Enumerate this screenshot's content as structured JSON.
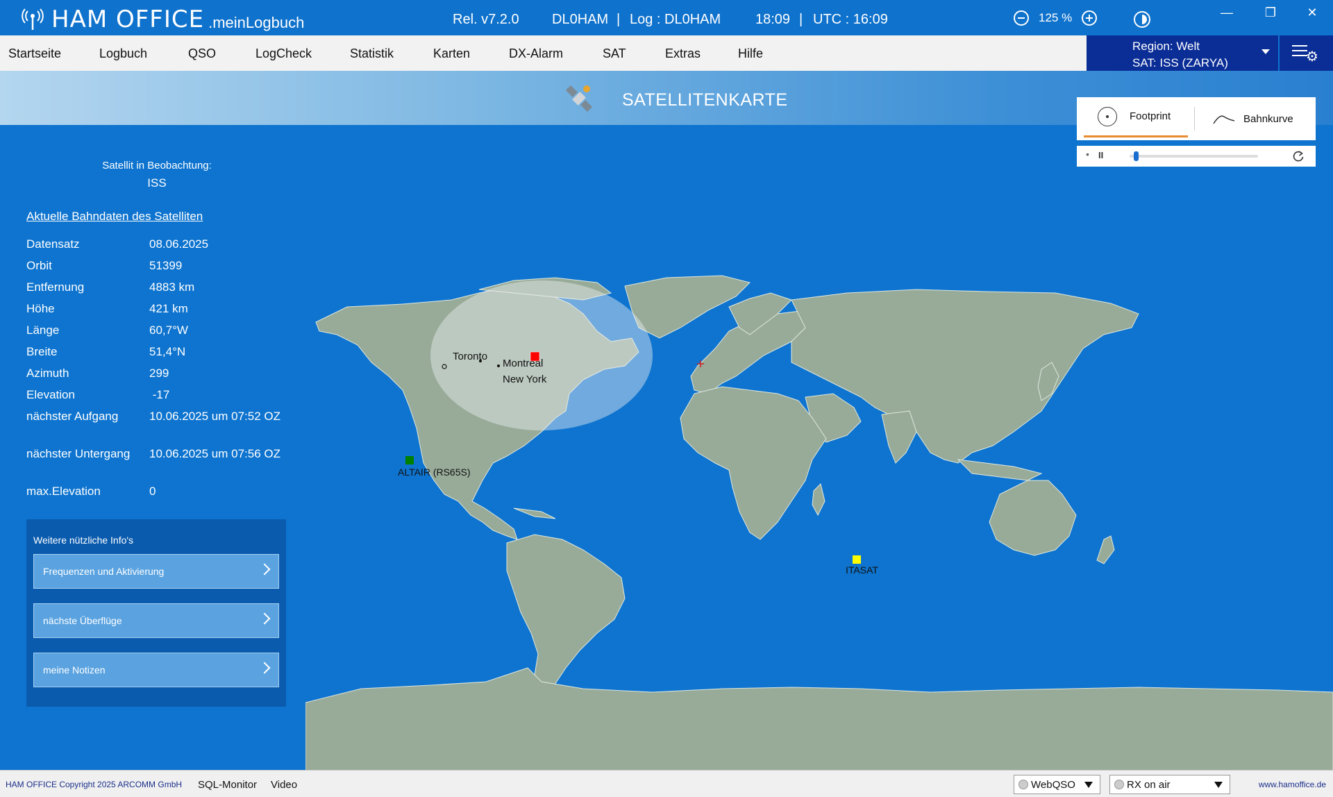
{
  "titlebar": {
    "app_name": "HAM OFFICE",
    "app_sub": ".meinLogbuch",
    "release": "Rel. v7.2.0",
    "callsign": "DL0HAM",
    "separator": "|",
    "log_label": "Log : DL0HAM",
    "local_time": "18:09",
    "utc": "UTC : 16:09",
    "zoom": "125 %",
    "min": "—",
    "restore": "❐",
    "close": "✕"
  },
  "menu": {
    "items": [
      "Startseite",
      "Logbuch",
      "QSO",
      "LogCheck",
      "Statistik",
      "Karten",
      "DX-Alarm",
      "SAT",
      "Extras",
      "Hilfe"
    ]
  },
  "region": {
    "line1": "Region: Welt",
    "line2": "SAT: ISS (ZARYA)"
  },
  "header": {
    "title": "SATELLITENKARTE"
  },
  "mode": {
    "footprint": "Footprint",
    "bahnkurve": "Bahnkurve",
    "slider_value": 0.05
  },
  "info": {
    "observe_label": "Satellit in Beobachtung:",
    "sat_name": "ISS",
    "section_link": "Aktuelle Bahndaten des Satelliten",
    "rows": [
      {
        "k": "Datensatz",
        "v": "08.06.2025"
      },
      {
        "k": "Orbit",
        "v": "51399"
      },
      {
        "k": "Entfernung",
        "v": "4883 km"
      },
      {
        "k": "Höhe",
        "v": "421 km"
      },
      {
        "k": "Länge",
        "v": "60,7°W"
      },
      {
        "k": "Breite",
        "v": "51,4°N"
      },
      {
        "k": "Azimuth",
        "v": "299"
      },
      {
        "k": "Elevation",
        "v": " -17"
      },
      {
        "k": "nächster Aufgang",
        "v": "10.06.2025 um 07:52 OZ"
      },
      {
        "k": "nächster Untergang",
        "v": "10.06.2025 um 07:56 OZ"
      },
      {
        "k": "max.Elevation",
        "v": "0"
      }
    ]
  },
  "more": {
    "title": "Weitere nützliche Info's",
    "buttons": [
      "Frequenzen und Aktivierung",
      "nächste Überflüge",
      "meine Notizen"
    ]
  },
  "map": {
    "cities": [
      "Toronto",
      "Montreal",
      "New York"
    ],
    "satellites": [
      {
        "name": "ISS",
        "label": "",
        "color": "#ff0000"
      },
      {
        "name": "ALTAIR",
        "label": "ALTAIR (RS65S)",
        "color": "#008000"
      },
      {
        "name": "ITASAT",
        "label": "ITASAT",
        "color": "#ffff00"
      }
    ]
  },
  "footer": {
    "copyright": "HAM OFFICE Copyright 2025 ARCOMM GmbH",
    "sql_monitor": "SQL-Monitor",
    "video": "Video",
    "webqso": "WebQSO",
    "rx": "RX on air",
    "homepage": "www.hamoffice.de"
  },
  "colors": {
    "ocean": "#0e74cf",
    "land": "#98ab99",
    "accent": "#e88a2e",
    "nav": "#0a2d96"
  }
}
